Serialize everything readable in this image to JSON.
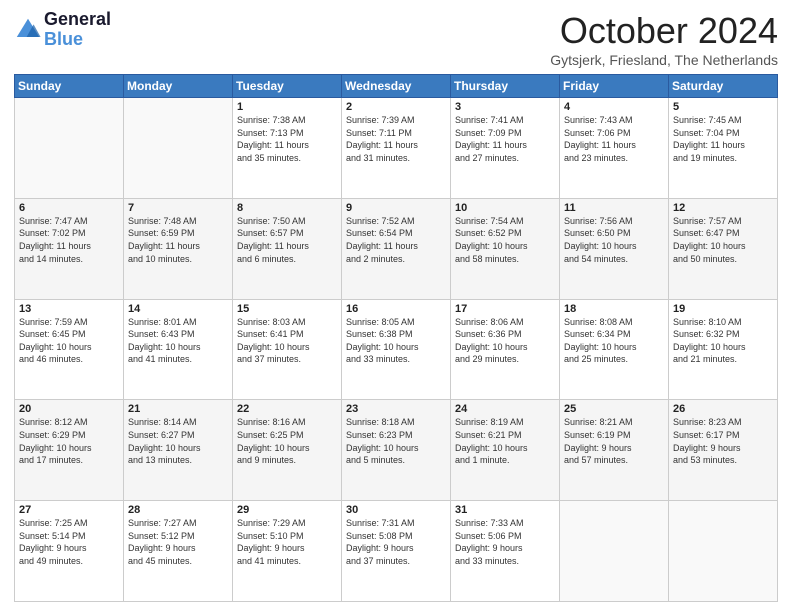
{
  "header": {
    "logo_line1": "General",
    "logo_line2": "Blue",
    "month": "October 2024",
    "location": "Gytsjerk, Friesland, The Netherlands"
  },
  "weekdays": [
    "Sunday",
    "Monday",
    "Tuesday",
    "Wednesday",
    "Thursday",
    "Friday",
    "Saturday"
  ],
  "weeks": [
    [
      {
        "day": "",
        "info": ""
      },
      {
        "day": "",
        "info": ""
      },
      {
        "day": "1",
        "info": "Sunrise: 7:38 AM\nSunset: 7:13 PM\nDaylight: 11 hours\nand 35 minutes."
      },
      {
        "day": "2",
        "info": "Sunrise: 7:39 AM\nSunset: 7:11 PM\nDaylight: 11 hours\nand 31 minutes."
      },
      {
        "day": "3",
        "info": "Sunrise: 7:41 AM\nSunset: 7:09 PM\nDaylight: 11 hours\nand 27 minutes."
      },
      {
        "day": "4",
        "info": "Sunrise: 7:43 AM\nSunset: 7:06 PM\nDaylight: 11 hours\nand 23 minutes."
      },
      {
        "day": "5",
        "info": "Sunrise: 7:45 AM\nSunset: 7:04 PM\nDaylight: 11 hours\nand 19 minutes."
      }
    ],
    [
      {
        "day": "6",
        "info": "Sunrise: 7:47 AM\nSunset: 7:02 PM\nDaylight: 11 hours\nand 14 minutes."
      },
      {
        "day": "7",
        "info": "Sunrise: 7:48 AM\nSunset: 6:59 PM\nDaylight: 11 hours\nand 10 minutes."
      },
      {
        "day": "8",
        "info": "Sunrise: 7:50 AM\nSunset: 6:57 PM\nDaylight: 11 hours\nand 6 minutes."
      },
      {
        "day": "9",
        "info": "Sunrise: 7:52 AM\nSunset: 6:54 PM\nDaylight: 11 hours\nand 2 minutes."
      },
      {
        "day": "10",
        "info": "Sunrise: 7:54 AM\nSunset: 6:52 PM\nDaylight: 10 hours\nand 58 minutes."
      },
      {
        "day": "11",
        "info": "Sunrise: 7:56 AM\nSunset: 6:50 PM\nDaylight: 10 hours\nand 54 minutes."
      },
      {
        "day": "12",
        "info": "Sunrise: 7:57 AM\nSunset: 6:47 PM\nDaylight: 10 hours\nand 50 minutes."
      }
    ],
    [
      {
        "day": "13",
        "info": "Sunrise: 7:59 AM\nSunset: 6:45 PM\nDaylight: 10 hours\nand 46 minutes."
      },
      {
        "day": "14",
        "info": "Sunrise: 8:01 AM\nSunset: 6:43 PM\nDaylight: 10 hours\nand 41 minutes."
      },
      {
        "day": "15",
        "info": "Sunrise: 8:03 AM\nSunset: 6:41 PM\nDaylight: 10 hours\nand 37 minutes."
      },
      {
        "day": "16",
        "info": "Sunrise: 8:05 AM\nSunset: 6:38 PM\nDaylight: 10 hours\nand 33 minutes."
      },
      {
        "day": "17",
        "info": "Sunrise: 8:06 AM\nSunset: 6:36 PM\nDaylight: 10 hours\nand 29 minutes."
      },
      {
        "day": "18",
        "info": "Sunrise: 8:08 AM\nSunset: 6:34 PM\nDaylight: 10 hours\nand 25 minutes."
      },
      {
        "day": "19",
        "info": "Sunrise: 8:10 AM\nSunset: 6:32 PM\nDaylight: 10 hours\nand 21 minutes."
      }
    ],
    [
      {
        "day": "20",
        "info": "Sunrise: 8:12 AM\nSunset: 6:29 PM\nDaylight: 10 hours\nand 17 minutes."
      },
      {
        "day": "21",
        "info": "Sunrise: 8:14 AM\nSunset: 6:27 PM\nDaylight: 10 hours\nand 13 minutes."
      },
      {
        "day": "22",
        "info": "Sunrise: 8:16 AM\nSunset: 6:25 PM\nDaylight: 10 hours\nand 9 minutes."
      },
      {
        "day": "23",
        "info": "Sunrise: 8:18 AM\nSunset: 6:23 PM\nDaylight: 10 hours\nand 5 minutes."
      },
      {
        "day": "24",
        "info": "Sunrise: 8:19 AM\nSunset: 6:21 PM\nDaylight: 10 hours\nand 1 minute."
      },
      {
        "day": "25",
        "info": "Sunrise: 8:21 AM\nSunset: 6:19 PM\nDaylight: 9 hours\nand 57 minutes."
      },
      {
        "day": "26",
        "info": "Sunrise: 8:23 AM\nSunset: 6:17 PM\nDaylight: 9 hours\nand 53 minutes."
      }
    ],
    [
      {
        "day": "27",
        "info": "Sunrise: 7:25 AM\nSunset: 5:14 PM\nDaylight: 9 hours\nand 49 minutes."
      },
      {
        "day": "28",
        "info": "Sunrise: 7:27 AM\nSunset: 5:12 PM\nDaylight: 9 hours\nand 45 minutes."
      },
      {
        "day": "29",
        "info": "Sunrise: 7:29 AM\nSunset: 5:10 PM\nDaylight: 9 hours\nand 41 minutes."
      },
      {
        "day": "30",
        "info": "Sunrise: 7:31 AM\nSunset: 5:08 PM\nDaylight: 9 hours\nand 37 minutes."
      },
      {
        "day": "31",
        "info": "Sunrise: 7:33 AM\nSunset: 5:06 PM\nDaylight: 9 hours\nand 33 minutes."
      },
      {
        "day": "",
        "info": ""
      },
      {
        "day": "",
        "info": ""
      }
    ]
  ]
}
